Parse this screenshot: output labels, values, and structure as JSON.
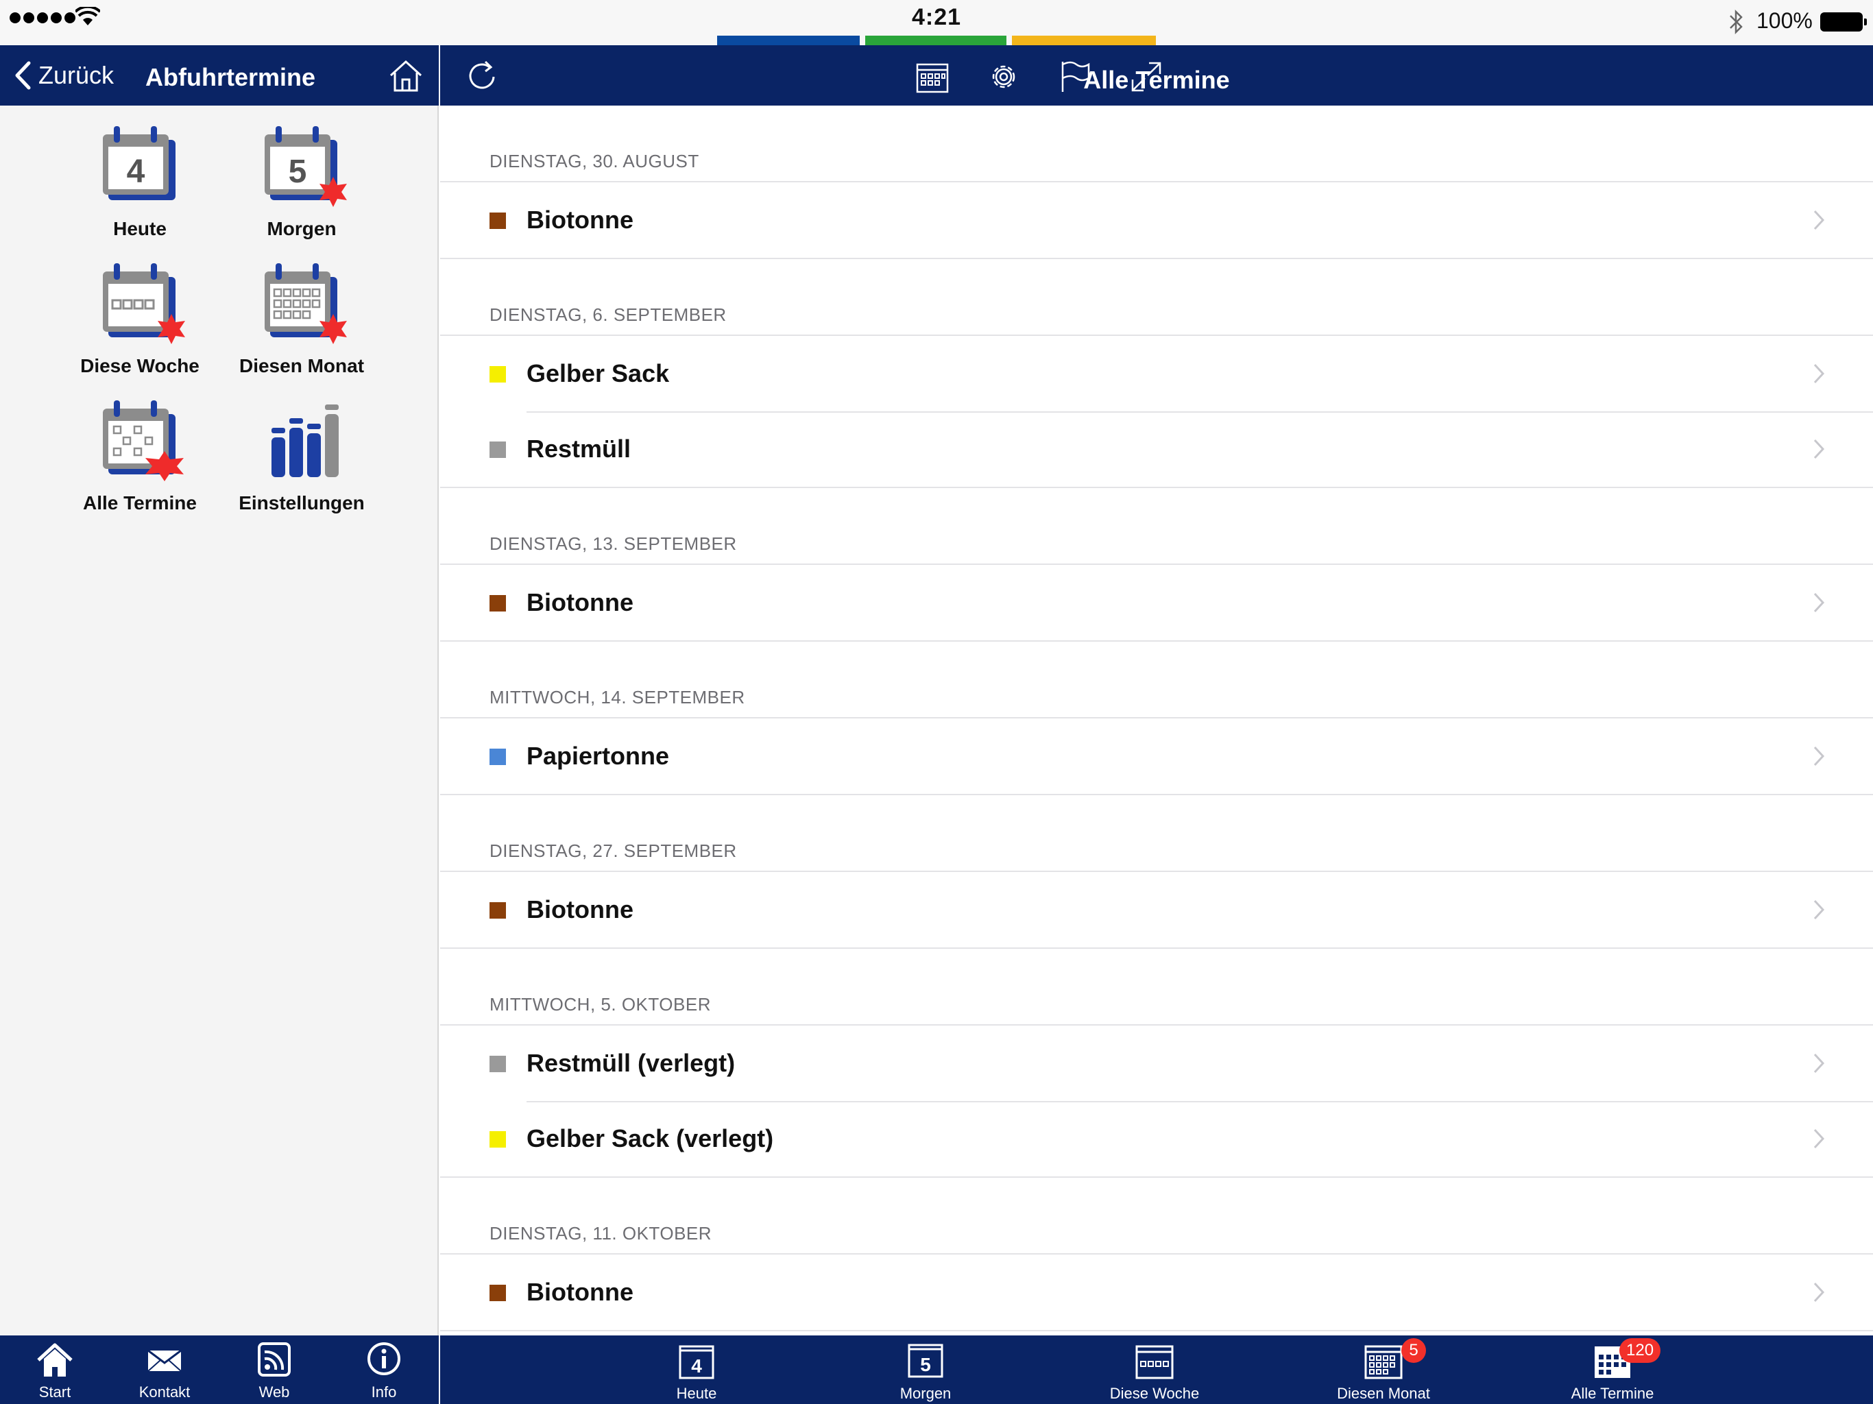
{
  "status_bar": {
    "time": "4:21",
    "battery": "100%",
    "strip_colors": [
      "#0a4aa0",
      "#2aa53a",
      "#f3b51b"
    ]
  },
  "left_header": {
    "back_label": "Zurück",
    "title": "Abfuhrtermine"
  },
  "tiles": [
    {
      "label": "Heute",
      "day": "4",
      "icon": "calendar-day-icon"
    },
    {
      "label": "Morgen",
      "day": "5",
      "icon": "calendar-day-icon"
    },
    {
      "label": "Diese Woche",
      "icon": "calendar-week-icon"
    },
    {
      "label": "Diesen Monat",
      "icon": "calendar-month-icon"
    },
    {
      "label": "Alle Termine",
      "icon": "calendar-all-icon"
    },
    {
      "label": "Einstellungen",
      "icon": "settings-sliders-icon"
    }
  ],
  "left_tabs": [
    {
      "label": "Start",
      "icon": "home-icon"
    },
    {
      "label": "Kontakt",
      "icon": "mail-icon"
    },
    {
      "label": "Web",
      "icon": "rss-icon"
    },
    {
      "label": "Info",
      "icon": "info-icon"
    }
  ],
  "right_header": {
    "title": "Alle Termine",
    "icons": [
      "calendar-grid-icon",
      "gear-icon",
      "flag-icon",
      "expand-icon"
    ]
  },
  "sections": [
    {
      "date": "DIENSTAG, 30. AUGUST",
      "items": [
        {
          "label": "Biotonne",
          "color": "#8a3f0a"
        }
      ]
    },
    {
      "date": "DIENSTAG, 6. SEPTEMBER",
      "items": [
        {
          "label": "Gelber Sack",
          "color": "#f5ef00"
        },
        {
          "label": "Restmüll",
          "color": "#9a9a9a"
        }
      ]
    },
    {
      "date": "DIENSTAG, 13. SEPTEMBER",
      "items": [
        {
          "label": "Biotonne",
          "color": "#8a3f0a"
        }
      ]
    },
    {
      "date": "MITTWOCH, 14. SEPTEMBER",
      "items": [
        {
          "label": "Papiertonne",
          "color": "#4a86d6"
        }
      ]
    },
    {
      "date": "DIENSTAG, 27. SEPTEMBER",
      "items": [
        {
          "label": "Biotonne",
          "color": "#8a3f0a"
        }
      ]
    },
    {
      "date": "MITTWOCH, 5. OKTOBER",
      "items": [
        {
          "label": "Restmüll (verlegt)",
          "color": "#9a9a9a"
        },
        {
          "label": "Gelber Sack (verlegt)",
          "color": "#f5ef00"
        }
      ]
    },
    {
      "date": "DIENSTAG, 11. OKTOBER",
      "items": [
        {
          "label": "Biotonne",
          "color": "#8a3f0a"
        }
      ]
    }
  ],
  "right_tabs": [
    {
      "label": "Heute",
      "day": "4",
      "badge": ""
    },
    {
      "label": "Morgen",
      "day": "5",
      "badge": ""
    },
    {
      "label": "Diese Woche",
      "badge": ""
    },
    {
      "label": "Diesen Monat",
      "badge": "5"
    },
    {
      "label": "Alle Termine",
      "badge": "120"
    }
  ],
  "colors": {
    "nav_blue": "#0a2465",
    "calendar_blue": "#1d3fa3",
    "calendar_grey": "#8c8c8c",
    "badge_red": "#f2302a"
  }
}
